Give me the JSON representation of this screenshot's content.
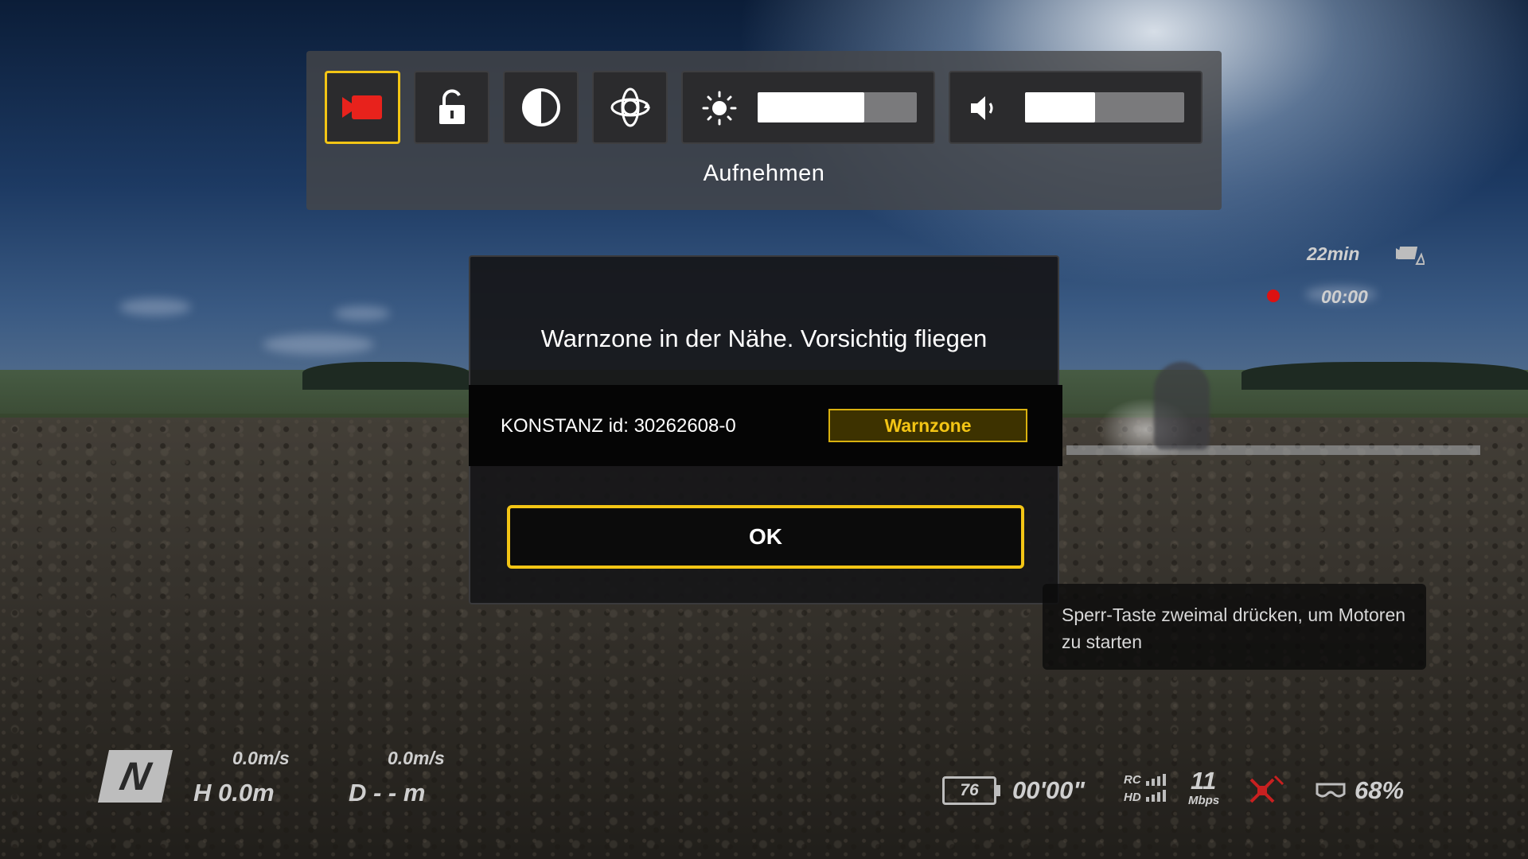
{
  "quick_menu": {
    "label": "Aufnehmen",
    "brightness_level": 0.67,
    "volume_level": 0.44
  },
  "dialog": {
    "title": "Warnzone in der Nähe. Vorsichtig fliegen",
    "zone_name": "KONSTANZ  id: 30262608-0",
    "zone_type": "Warnzone",
    "ok_label": "OK"
  },
  "tip": {
    "text": "Sperr-Taste zweimal drücken, um Motoren zu starten"
  },
  "hud": {
    "flight_mode": "N",
    "vertical_speed": "0.0m/s",
    "horizontal_speed": "0.0m/s",
    "height": "H 0.0m",
    "distance": "D - - m",
    "record_remaining": "22min",
    "record_time": "00:00",
    "temperature": "76",
    "flight_time": "00'00\"",
    "rc_label": "RC",
    "hd_label": "HD",
    "bitrate": "11",
    "bitrate_unit": "Mbps",
    "goggles_battery": "68%"
  },
  "colors": {
    "accent": "#f3c515",
    "record_red": "#e8221c",
    "warning_bg": "#3d3200"
  }
}
